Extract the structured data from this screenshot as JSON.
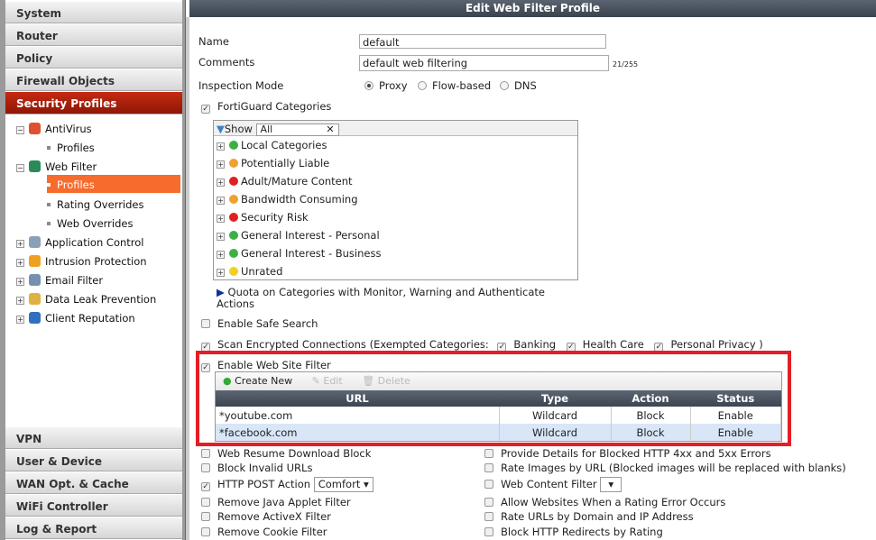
{
  "sidebar": {
    "sections_top": [
      "System",
      "Router",
      "Policy",
      "Firewall Objects",
      "Security Profiles"
    ],
    "tree": [
      {
        "label": "AntiVirus",
        "children": [
          "Profiles"
        ]
      },
      {
        "label": "Web Filter",
        "children": [
          "Profiles",
          "Rating Overrides",
          "Web Overrides"
        ]
      },
      {
        "label": "Application Control"
      },
      {
        "label": "Intrusion Protection"
      },
      {
        "label": "Email Filter"
      },
      {
        "label": "Data Leak Prevention"
      },
      {
        "label": "Client Reputation"
      }
    ],
    "sections_bottom": [
      "VPN",
      "User & Device",
      "WAN Opt. & Cache",
      "WiFi Controller",
      "Log & Report"
    ]
  },
  "header": {
    "title": "Edit Web Filter Profile"
  },
  "form": {
    "name_label": "Name",
    "name_value": "default",
    "comments_label": "Comments",
    "comments_value": "default web filtering",
    "comments_count": "21/255",
    "inspection_label": "Inspection Mode",
    "modes": [
      "Proxy",
      "Flow-based",
      "DNS"
    ],
    "fortiguard_label": "FortiGuard Categories",
    "show_label": "Show",
    "show_value": "All",
    "categories": [
      {
        "label": "Local Categories",
        "color": "#3cb043"
      },
      {
        "label": "Potentially Liable",
        "color": "#f0a030"
      },
      {
        "label": "Adult/Mature Content",
        "color": "#e02020"
      },
      {
        "label": "Bandwidth Consuming",
        "color": "#f0a030"
      },
      {
        "label": "Security Risk",
        "color": "#e02020"
      },
      {
        "label": "General Interest - Personal",
        "color": "#3cb043"
      },
      {
        "label": "General Interest - Business",
        "color": "#3cb043"
      },
      {
        "label": "Unrated",
        "color": "#f0d020"
      }
    ],
    "quota_label": "Quota on Categories with Monitor, Warning and Authenticate Actions",
    "safe_search": "Enable Safe Search",
    "scan_encrypted": "Scan Encrypted Connections (Exempted Categories:",
    "exempt": [
      "Banking",
      "Health Care",
      "Personal Privacy )"
    ],
    "web_site_filter": "Enable Web Site Filter",
    "toolbar": {
      "create": "Create New",
      "edit": "Edit",
      "delete": "Delete"
    },
    "columns": [
      "URL",
      "Type",
      "Action",
      "Status"
    ],
    "rows": [
      [
        "*youtube.com",
        "Wildcard",
        "Block",
        "Enable"
      ],
      [
        "*facebook.com",
        "Wildcard",
        "Block",
        "Enable"
      ]
    ],
    "options_left": [
      "Web Resume Download Block",
      "Block Invalid URLs",
      "HTTP POST Action",
      "Remove Java Applet Filter",
      "Remove ActiveX Filter",
      "Remove Cookie Filter"
    ],
    "post_action_value": "Comfort",
    "options_right": [
      "Provide Details for Blocked HTTP 4xx and 5xx Errors",
      "Rate Images by URL (Blocked images will be replaced with blanks)",
      "Web Content Filter",
      "Allow Websites When a Rating Error Occurs",
      "Rate URLs by Domain and IP Address",
      "Block HTTP Redirects by Rating"
    ]
  }
}
